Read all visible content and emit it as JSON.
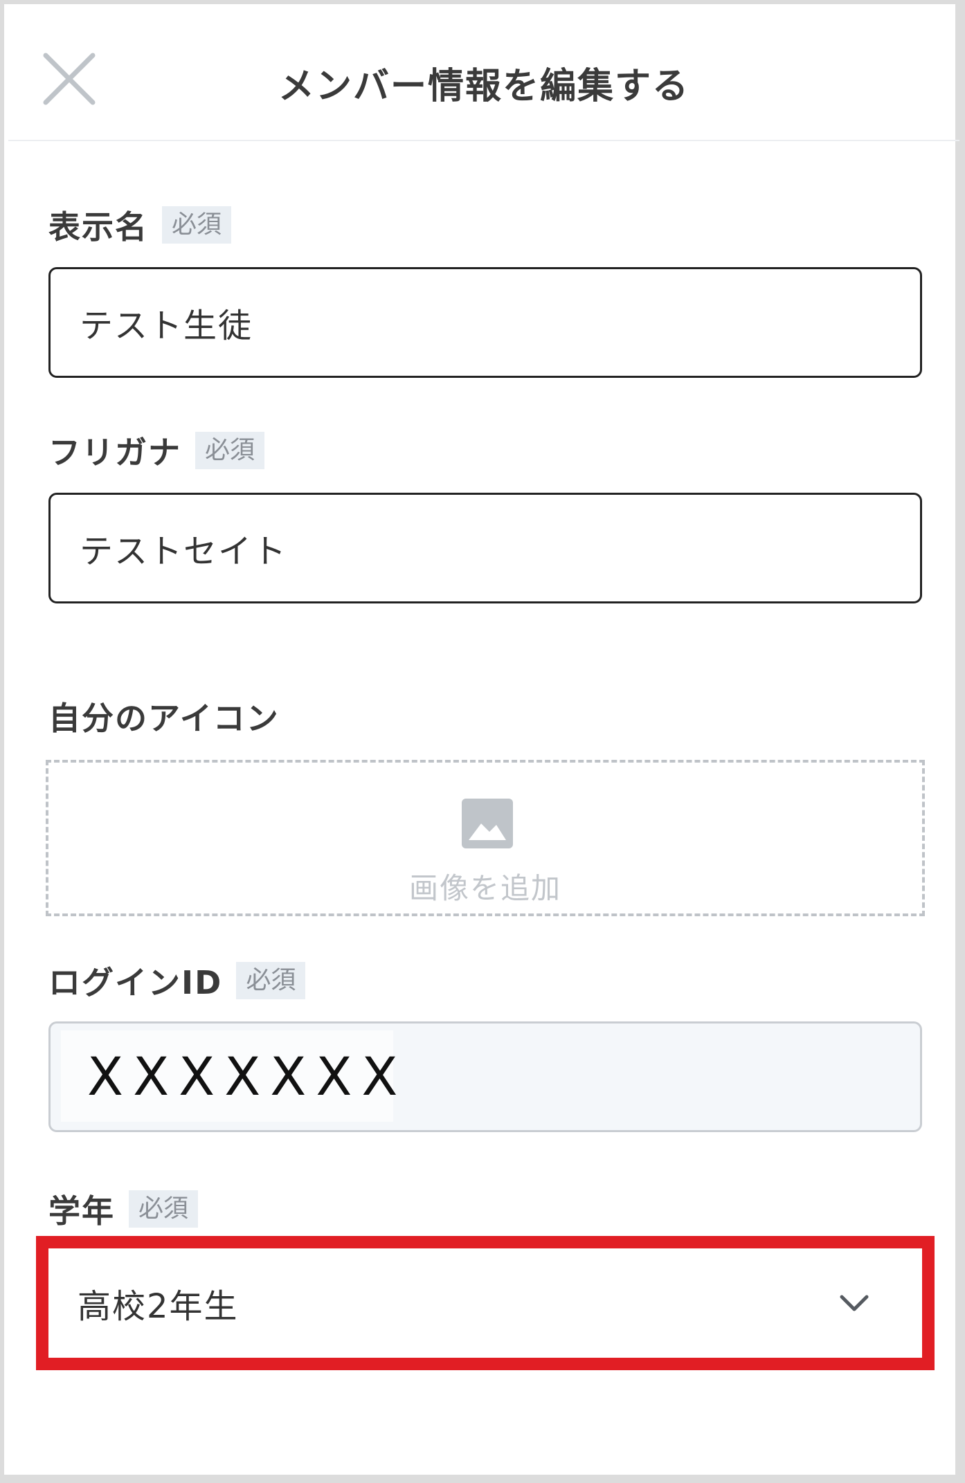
{
  "header": {
    "title": "メンバー情報を編集する",
    "close_icon": "close-icon"
  },
  "required_badge": "必須",
  "display_name": {
    "label": "表示名",
    "value": "テスト生徒"
  },
  "furigana": {
    "label": "フリガナ",
    "value": "テストセイト"
  },
  "icon": {
    "label": "自分のアイコン",
    "upload_label": "画像を追加",
    "upload_icon": "image-icon"
  },
  "login_id": {
    "label": "ログインID",
    "value": "XXXXXXX"
  },
  "grade": {
    "label": "学年",
    "value": "高校2年生",
    "dropdown_icon": "chevron-down-icon"
  },
  "colors": {
    "highlight": "#e11e24",
    "badge_bg": "#e9eef3",
    "readonly_bg": "#f4f7fa"
  }
}
